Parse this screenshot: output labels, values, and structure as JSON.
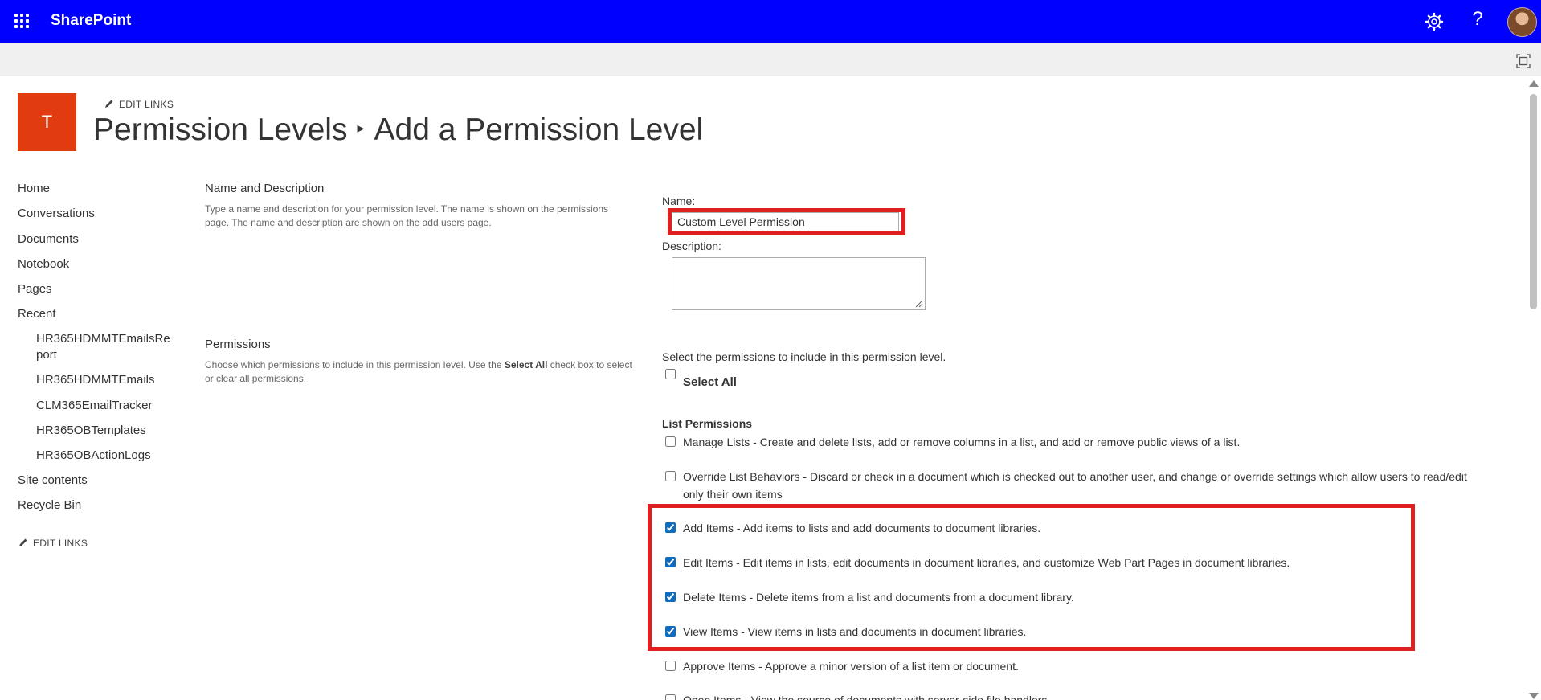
{
  "suite_bar": {
    "brand": "SharePoint",
    "help_glyph": "?",
    "icons": [
      "app-launcher-icon",
      "settings-gear-icon",
      "help-icon",
      "user-avatar"
    ],
    "color": "#0000ff"
  },
  "site": {
    "logo_letter": "T",
    "logo_color": "#e03c0f",
    "edit_links_label": "EDIT LINKS"
  },
  "title": {
    "parent": "Permission Levels",
    "separator": "▸",
    "current": "Add a Permission Level"
  },
  "nav": {
    "items": [
      {
        "label": "Home"
      },
      {
        "label": "Conversations"
      },
      {
        "label": "Documents"
      },
      {
        "label": "Notebook"
      },
      {
        "label": "Pages"
      },
      {
        "label": "Recent"
      }
    ],
    "recent_items": [
      {
        "label": "HR365HDMMTEmailsRe\nport"
      },
      {
        "label": "HR365HDMMTEmails"
      },
      {
        "label": "CLM365EmailTracker"
      },
      {
        "label": "HR365OBTemplates"
      },
      {
        "label": "HR365OBActionLogs"
      }
    ],
    "bottom_items": [
      {
        "label": "Site contents"
      },
      {
        "label": "Recycle Bin"
      }
    ],
    "edit_links_label": "EDIT LINKS"
  },
  "name_section": {
    "title": "Name and Description",
    "description": "Type a name and description for your permission level.  The name is shown on the permissions page.  The name and description are shown on the add users page.",
    "name_label": "Name:",
    "name_value": "Custom Level Permission",
    "description_label": "Description:",
    "description_value": ""
  },
  "permissions_section": {
    "title": "Permissions",
    "description_before": "Choose which permissions to include in this permission level.  Use the ",
    "description_bold": "Select All",
    "description_after": " check box to select or clear all permissions.",
    "intro": "Select the permissions to include in this permission level.",
    "select_all_label": "Select All",
    "select_all_checked": false,
    "list_permissions_title": "List Permissions",
    "list_permissions": [
      {
        "label": "Manage Lists  -  Create and delete lists, add or remove columns in a list, and add or remove public views of a list.",
        "checked": false
      },
      {
        "label": "Override List Behaviors  -  Discard or check in a document which is checked out to another user, and change or override settings which allow users to read/edit only their own items",
        "checked": false
      },
      {
        "label": "Add Items  -  Add items to lists and add documents to document libraries.",
        "checked": true
      },
      {
        "label": "Edit Items  -  Edit items in lists, edit documents in document libraries, and customize Web Part Pages in document libraries.",
        "checked": true
      },
      {
        "label": "Delete Items  -  Delete items from a list and documents from a document library.",
        "checked": true
      },
      {
        "label": "View Items  -  View items in lists and documents in document libraries.",
        "checked": true
      },
      {
        "label": "Approve Items  -  Approve a minor version of a list item or document.",
        "checked": false
      },
      {
        "label": "Open Items  -  View the source of documents with server-side file handlers.",
        "checked": false
      }
    ]
  },
  "highlight_color": "#e02020"
}
